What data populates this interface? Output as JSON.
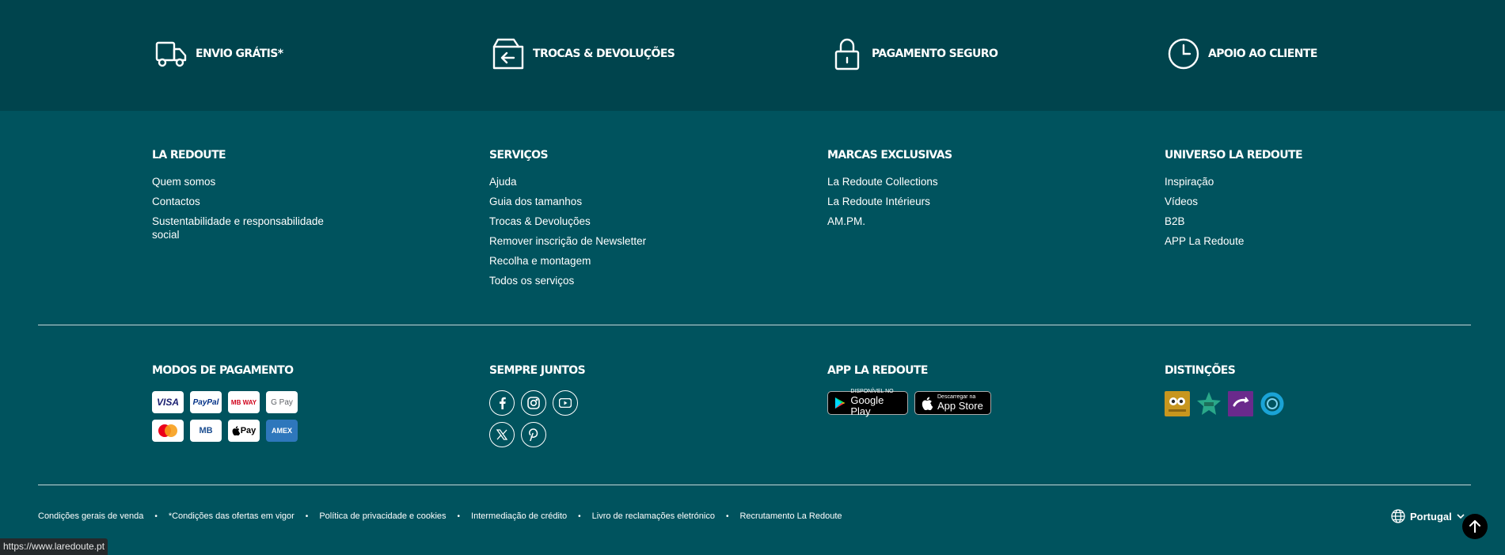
{
  "benefits": [
    {
      "label": "ENVIO GRÁTIS*",
      "icon": "truck-icon"
    },
    {
      "label": "TROCAS & DEVOLUÇÕES",
      "icon": "return-box-icon"
    },
    {
      "label": "PAGAMENTO SEGURO",
      "icon": "padlock-icon"
    },
    {
      "label": "APOIO AO CLIENTE",
      "icon": "clock-icon"
    }
  ],
  "columns": [
    {
      "title": "LA REDOUTE",
      "links": [
        "Quem somos",
        "Contactos",
        "Sustentabilidade e responsabilidade social"
      ]
    },
    {
      "title": "SERVIÇOS",
      "links": [
        "Ajuda",
        "Guia dos tamanhos",
        "Trocas & Devoluções",
        "Remover inscrição de Newsletter",
        "Recolha e montagem",
        "Todos os serviços"
      ]
    },
    {
      "title": "MARCAS EXCLUSIVAS",
      "links": [
        "La Redoute Collections",
        "La Redoute Intérieurs",
        "AM.PM."
      ]
    },
    {
      "title": "UNIVERSO LA REDOUTE",
      "links": [
        "Inspiração",
        "Vídeos",
        "B2B",
        "APP La Redoute"
      ]
    }
  ],
  "payments": {
    "title": "MODOS DE PAGAMENTO",
    "cards": {
      "visa": "VISA",
      "paypal": "PayPal",
      "mbway": "MB WAY",
      "gpay": "G Pay",
      "mb": "MB",
      "applepay": "Pay",
      "amex": "AMEX"
    }
  },
  "social": {
    "title": "SEMPRE JUNTOS",
    "icons": [
      "facebook-icon",
      "instagram-icon",
      "youtube-icon",
      "x-icon",
      "pinterest-icon"
    ]
  },
  "app": {
    "title": "APP LA REDOUTE",
    "google_small": "DISPONÍVEL NO",
    "google_big": "Google Play",
    "apple_small": "Descarregar na",
    "apple_big": "App Store"
  },
  "awards": {
    "title": "DISTINÇÕES"
  },
  "legal": {
    "links": [
      "Condições gerais de venda",
      "*Condições das ofertas em vigor",
      "Política de privacidade e cookies",
      "Intermediação de crédito",
      "Livro de reclamações eletrónico",
      "Recrutamento La Redoute"
    ]
  },
  "country": {
    "label": "Portugal"
  },
  "status_url": "https://www.laredoute.pt",
  "colors": {
    "band_top": "#00444d",
    "background": "#00535e",
    "text": "#ffffff"
  }
}
